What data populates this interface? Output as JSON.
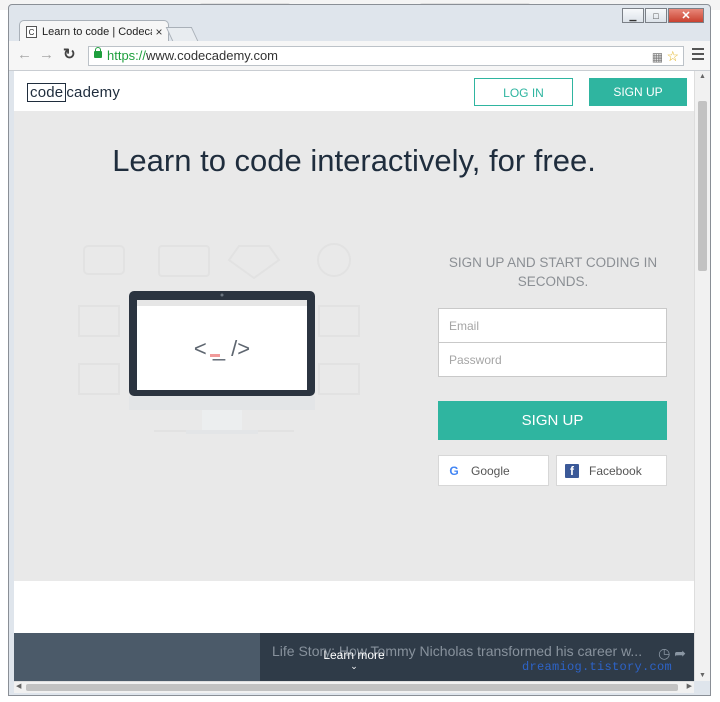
{
  "browser": {
    "tab_title": "Learn to code | Codecade",
    "tab_close": "×",
    "favicon_glyph": "C",
    "url_scheme": "https://",
    "url_host": "www.codecademy.com",
    "back_icon": "arrow-left-icon",
    "forward_icon": "arrow-right-icon",
    "reload_icon": "reload-icon",
    "window_controls": {
      "minimize": "▁",
      "maximize": "□",
      "close": "✕"
    }
  },
  "site": {
    "logo_boxed": "code",
    "logo_rest": "cademy",
    "login_label": "LOG IN",
    "signup_label": "SIGN UP",
    "headline": "Learn to code interactively, for free.",
    "code_glyph": "< _ />",
    "signup_panel": {
      "title": "SIGN UP AND START CODING IN SECONDS.",
      "email_placeholder": "Email",
      "password_placeholder": "Password",
      "submit_label": "SIGN UP",
      "google_label": "Google",
      "facebook_label": "Facebook"
    },
    "footer": {
      "video_caption": "Life Story: How Tommy Nicholas transformed his career w...",
      "learn_more": "Learn more",
      "chevron": "⌄"
    }
  },
  "watermark": "dreamiog.tistory.com",
  "colors": {
    "accent": "#2fb5a0",
    "navy": "#1f2d3d",
    "hero_bg": "#e9e9e9"
  }
}
